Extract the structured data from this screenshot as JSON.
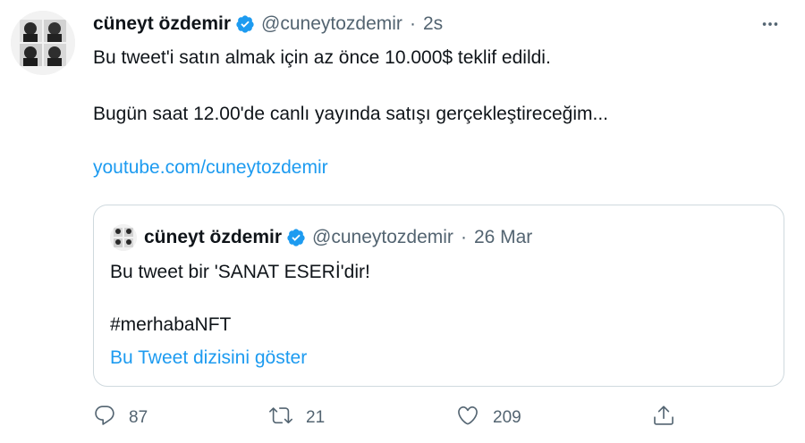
{
  "tweet": {
    "author_name": "cüneyt özdemir",
    "handle": "@cuneytozdemir",
    "separator": "·",
    "time": "2s",
    "text_line1": "Bu tweet'i satın almak için az önce 10.000$ teklif edildi.",
    "text_line2": "Bugün saat 12.00'de canlı yayında satışı gerçekleştireceğim...",
    "link": "youtube.com/cuneytozdemir",
    "more_icon": "more-horizontal-icon",
    "verified_icon": "verified-badge-icon"
  },
  "quote": {
    "author_name": "cüneyt özdemir",
    "handle": "@cuneytozdemir",
    "separator": "·",
    "date": "26 Mar",
    "text_line1": "Bu tweet bir 'SANAT ESERİ'dir!",
    "hashtag": "#merhabaNFT",
    "thread_link": "Bu Tweet dizisini göster"
  },
  "actions": {
    "replies": "87",
    "retweets": "21",
    "likes": "209",
    "icons": [
      "reply-icon",
      "retweet-icon",
      "like-icon",
      "share-icon"
    ]
  },
  "colors": {
    "link": "#1d9bf0",
    "secondary_text": "#536471",
    "verified": "#1d9bf0",
    "border": "#cfd9de"
  }
}
